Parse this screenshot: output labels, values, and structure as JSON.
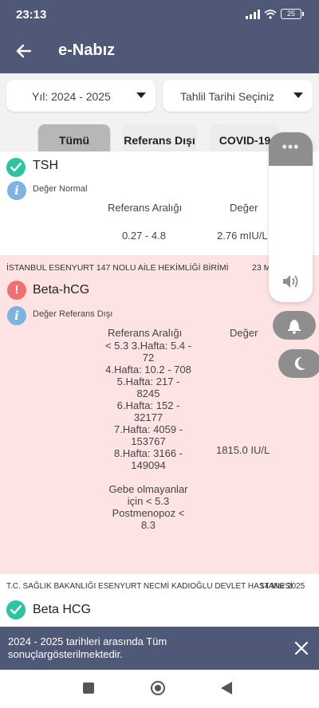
{
  "status_bar": {
    "time": "23:13",
    "battery": "25"
  },
  "app_bar": {
    "title": "e-Nabız"
  },
  "filters": {
    "year": "Yıl: 2024 - 2025",
    "date": "Tahlil Tarihi Seçiniz"
  },
  "tabs": [
    {
      "label": "Tümü",
      "active": true
    },
    {
      "label": "Referans Dışı",
      "active": false
    },
    {
      "label": "COVID-19",
      "active": false
    }
  ],
  "results": [
    {
      "name": "TSH",
      "status": "Değer Normal",
      "ref_header": "Referans Aralığı",
      "value_header": "Değer",
      "reference": "0.27 - 4.8",
      "value": "2.76 mIU/L"
    },
    {
      "institution": "İSTANBUL ESENYURT 147 NOLU AİLE HEKİMLİĞİ BİRİMİ",
      "date": "23 M",
      "name": "Beta-hCG",
      "status": "Değer Referans Dışı",
      "ref_header": "Referans Aralığı",
      "value_header": "Değer",
      "reference_lines": [
        "< 5.3  3.Hafta: 5.4 -",
        "72",
        "4.Hafta: 10.2 - 708",
        "5.Hafta: 217 -",
        "8245",
        "6.Hafta: 152 -",
        "32177",
        "7.Hafta: 4059 -",
        "153767",
        "8.Hafta: 3166 -",
        "149094",
        "",
        "Gebe olmayanlar",
        "için < 5.3",
        "Postmenopoz   <",
        "8.3"
      ],
      "value": "1815.0 IU/L"
    },
    {
      "institution": "T.C. SAĞLIK BAKANLIĞI ESENYURT NECMİ KADIOĞLU DEVLET HASTANESİ",
      "date": "14 Mar 2025",
      "name": "Beta HCG"
    }
  ],
  "snackbar": {
    "message": "2024 - 2025 tarihleri arasında Tüm sonuçlargösterilmektedir."
  },
  "icons": [
    "back-arrow-icon",
    "caret-down-icon",
    "check-icon",
    "info-icon",
    "warning-icon",
    "volume-icon",
    "bell-icon",
    "moon-icon",
    "close-icon"
  ],
  "colors": {
    "header": "#4f5877",
    "out_of_range_bg": "#fde3e3",
    "check": "#2ec4a0",
    "info": "#7db3e0",
    "warn": "#f07070"
  }
}
